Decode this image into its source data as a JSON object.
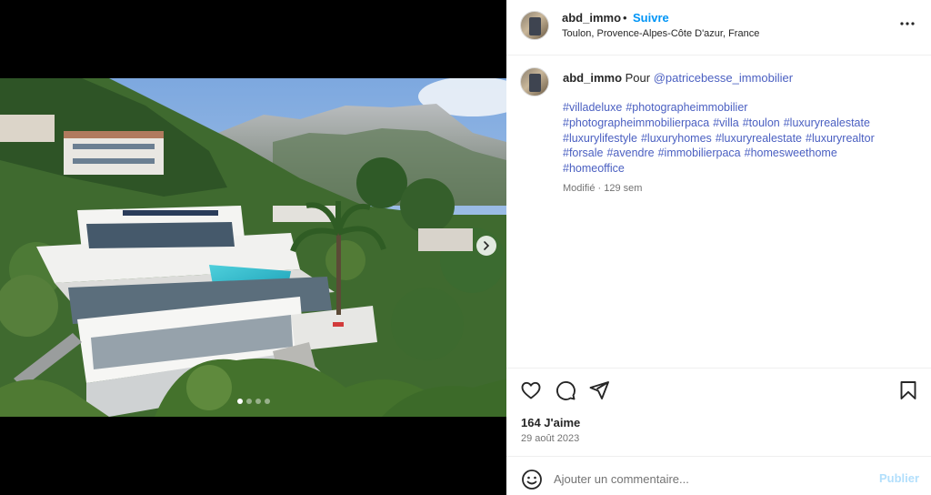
{
  "post": {
    "username": "abd_immo",
    "separator": "•",
    "follow_label": "Suivre",
    "location": "Toulon, Provence-Alpes-Côte D'azur, France",
    "more_icon": "more-horizontal-icon"
  },
  "caption": {
    "username": "abd_immo",
    "text": "Pour",
    "mention": "@patricebesse_immobilier",
    "hashtags": [
      "#villadeluxe",
      "#photographeimmobilier",
      "#photographeimmobilierpaca",
      "#villa",
      "#toulon",
      "#luxuryrealestate",
      "#luxurylifestyle",
      "#luxuryhomes",
      "#luxuryrealestate",
      "#luxuryrealtor",
      "#forsale",
      "#avendre",
      "#immobilierpaca",
      "#homesweethome",
      "#homeoffice"
    ],
    "edited": "Modifié",
    "meta_separator": "·",
    "age": "129 sem"
  },
  "media": {
    "carousel_total": 4,
    "carousel_active_index": 0,
    "next_icon": "chevron-right-icon"
  },
  "actions": {
    "like_icon": "heart-icon",
    "comment_icon": "comment-icon",
    "share_icon": "send-icon",
    "save_icon": "bookmark-icon"
  },
  "stats": {
    "likes": "164 J'aime",
    "date": "29 août 2023"
  },
  "comment": {
    "emoji_icon": "smiley-icon",
    "placeholder": "Ajouter un commentaire...",
    "publish_label": "Publier"
  },
  "colors": {
    "link_blue": "#0095f6",
    "hashtag_blue": "#4a5fc1",
    "publish_disabled": "#b2dffc"
  }
}
